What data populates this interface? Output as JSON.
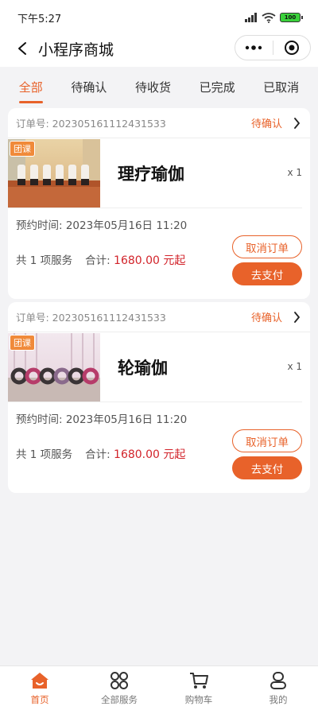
{
  "status_bar": {
    "time": "下午5:27",
    "battery": "100"
  },
  "nav": {
    "title": "小程序商城"
  },
  "tabs": [
    {
      "label": "全部",
      "active": true
    },
    {
      "label": "待确认",
      "active": false
    },
    {
      "label": "待收货",
      "active": false
    },
    {
      "label": "已完成",
      "active": false
    },
    {
      "label": "已取消",
      "active": false
    }
  ],
  "orders": [
    {
      "order_no": "订单号: 202305161112431533",
      "status": "待确认",
      "tag": "团课",
      "product_name": "理疗瑜伽",
      "qty": "x 1",
      "appoint_time": "预约时间: 2023年05月16日 11:20",
      "count_text": "共 1 项服务",
      "total_label": "合计:",
      "total_price": "1680.00 元起",
      "cancel_label": "取消订单",
      "pay_label": "去支付"
    },
    {
      "order_no": "订单号: 202305161112431533",
      "status": "待确认",
      "tag": "团课",
      "product_name": "轮瑜伽",
      "qty": "x 1",
      "appoint_time": "预约时间: 2023年05月16日 11:20",
      "count_text": "共 1 项服务",
      "total_label": "合计:",
      "total_price": "1680.00 元起",
      "cancel_label": "取消订单",
      "pay_label": "去支付"
    }
  ],
  "tabbar": [
    {
      "label": "首页",
      "icon": "home-icon",
      "active": true
    },
    {
      "label": "全部服务",
      "icon": "grid-icon",
      "active": false
    },
    {
      "label": "购物车",
      "icon": "cart-icon",
      "active": false
    },
    {
      "label": "我的",
      "icon": "user-icon",
      "active": false
    }
  ],
  "colors": {
    "accent": "#e8622a",
    "price": "#d2232a",
    "background": "#f3f3f5"
  }
}
